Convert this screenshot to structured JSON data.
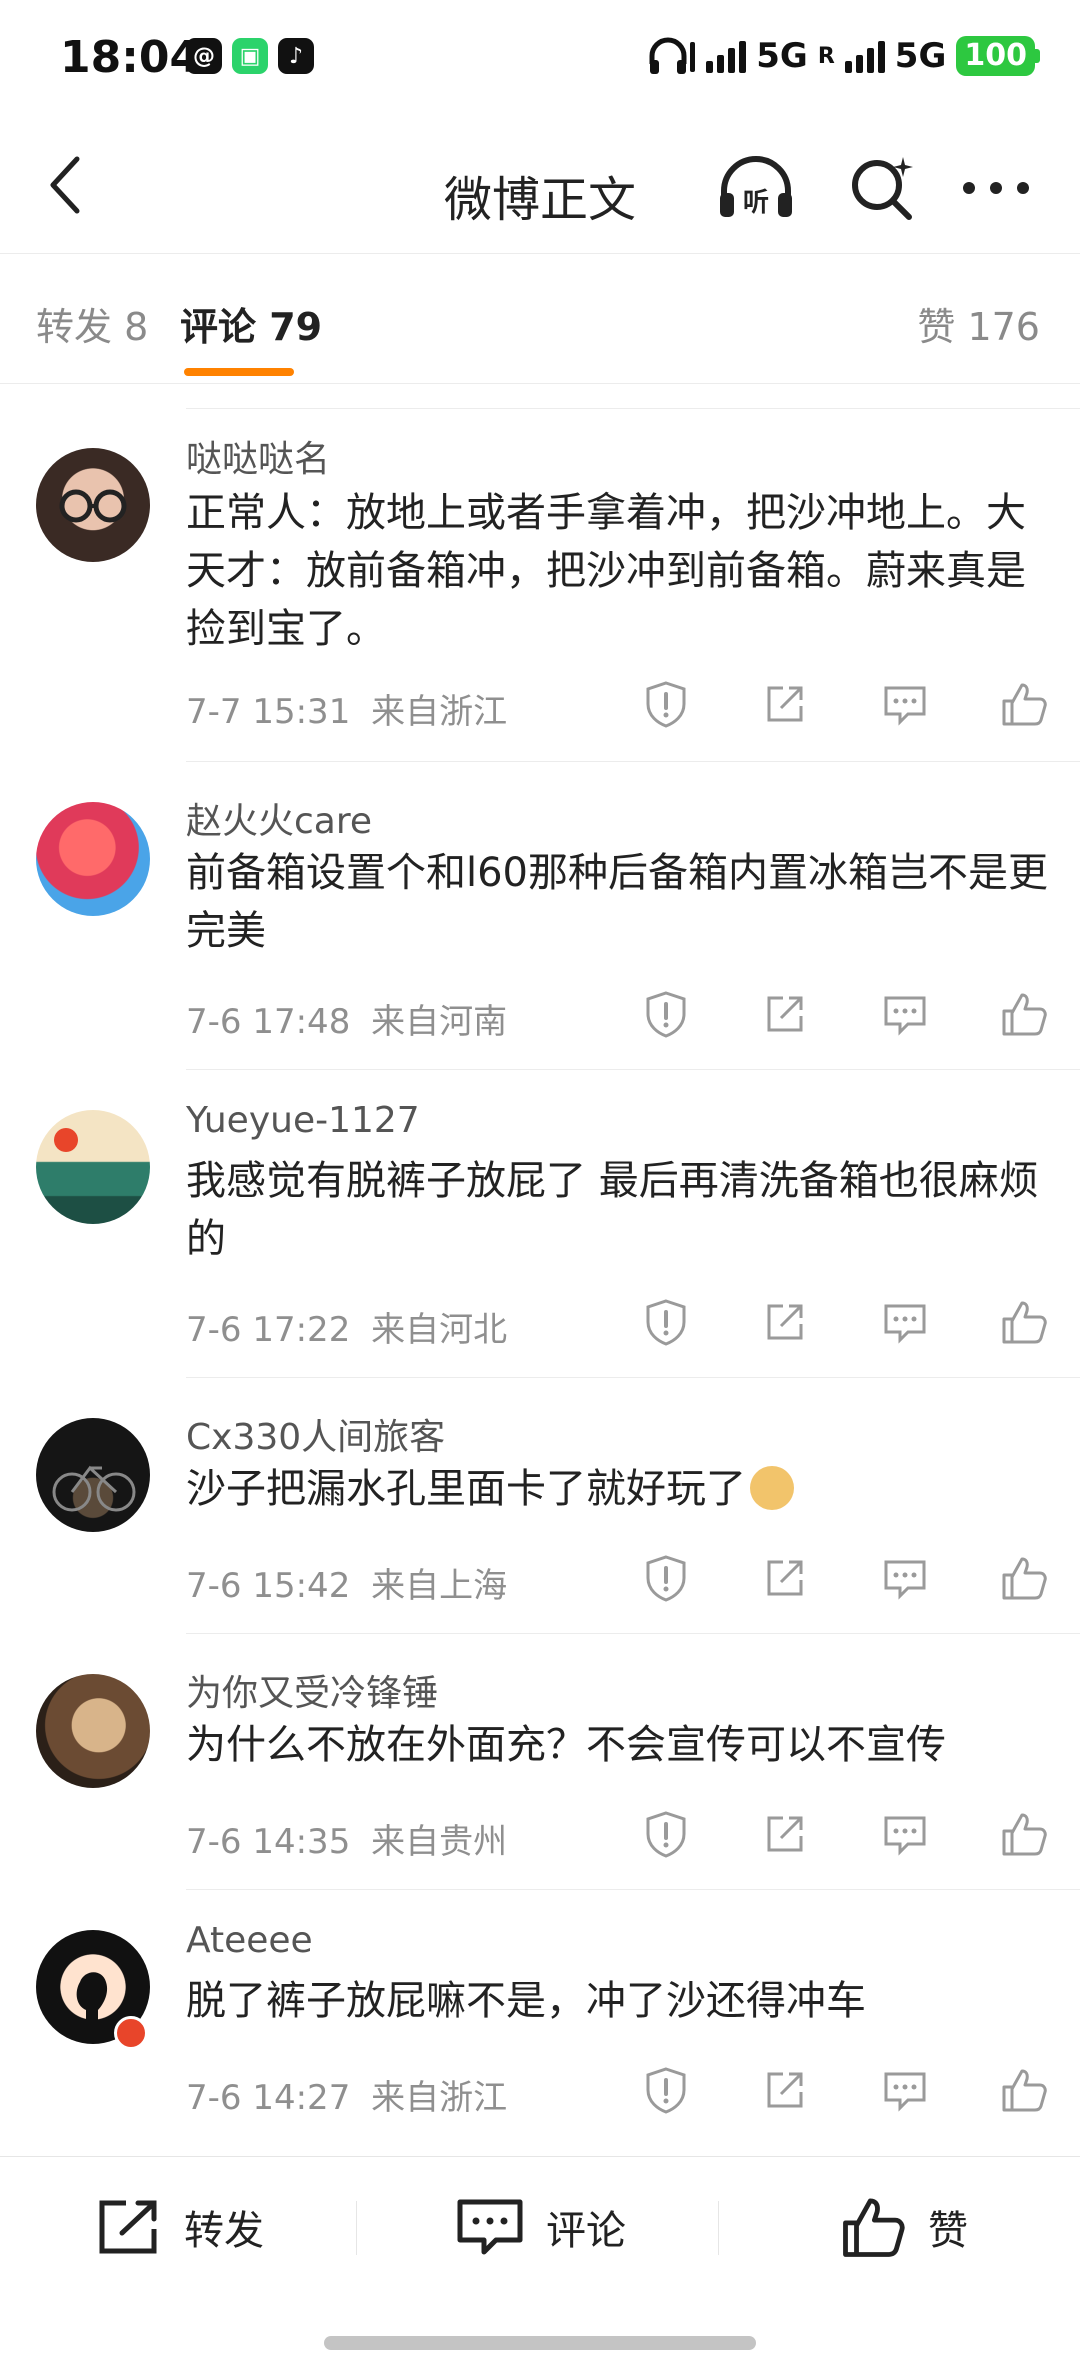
{
  "status_bar": {
    "time": "18:04",
    "network_1": "5G",
    "network_2": "5G",
    "roaming": "R",
    "battery": "100"
  },
  "nav": {
    "title": "微博正文",
    "listen_label": "听"
  },
  "tabs": {
    "repost": "转发 8",
    "comment": "评论 79",
    "like": "赞 176"
  },
  "comments": [
    {
      "user": "哒哒哒名",
      "text": "正常人：放地上或者手拿着冲，把沙冲地上。大天才：放前备箱冲，把沙冲到前备箱。蔚来真是捡到宝了。",
      "time": "7-7 15:31",
      "location": "来自浙江"
    },
    {
      "user": "赵火火care",
      "text": "前备箱设置个和l60那种后备箱内置冰箱岂不是更完美",
      "time": "7-6 17:48",
      "location": "来自河南"
    },
    {
      "user": "Yueyue-1127",
      "text": "我感觉有脱裤子放屁了 最后再清洗备箱也很麻烦的",
      "time": "7-6 17:22",
      "location": "来自河北"
    },
    {
      "user": "Cx330人间旅客",
      "text": "沙子把漏水孔里面卡了就好玩了",
      "time": "7-6 15:42",
      "location": "来自上海"
    },
    {
      "user": "为你又受冷锋锤",
      "text": "为什么不放在外面充？不会宣传可以不宣传",
      "time": "7-6 14:35",
      "location": "来自贵州"
    },
    {
      "user": "Ateeee",
      "text": "脱了裤子放屁嘛不是，冲了沙还得冲车",
      "time": "7-6 14:27",
      "location": "来自浙江"
    }
  ],
  "bottom_bar": {
    "repost": "转发",
    "comment": "评论",
    "like": "赞"
  },
  "colors": {
    "accent": "#ff8200",
    "battery": "#2dc840"
  }
}
